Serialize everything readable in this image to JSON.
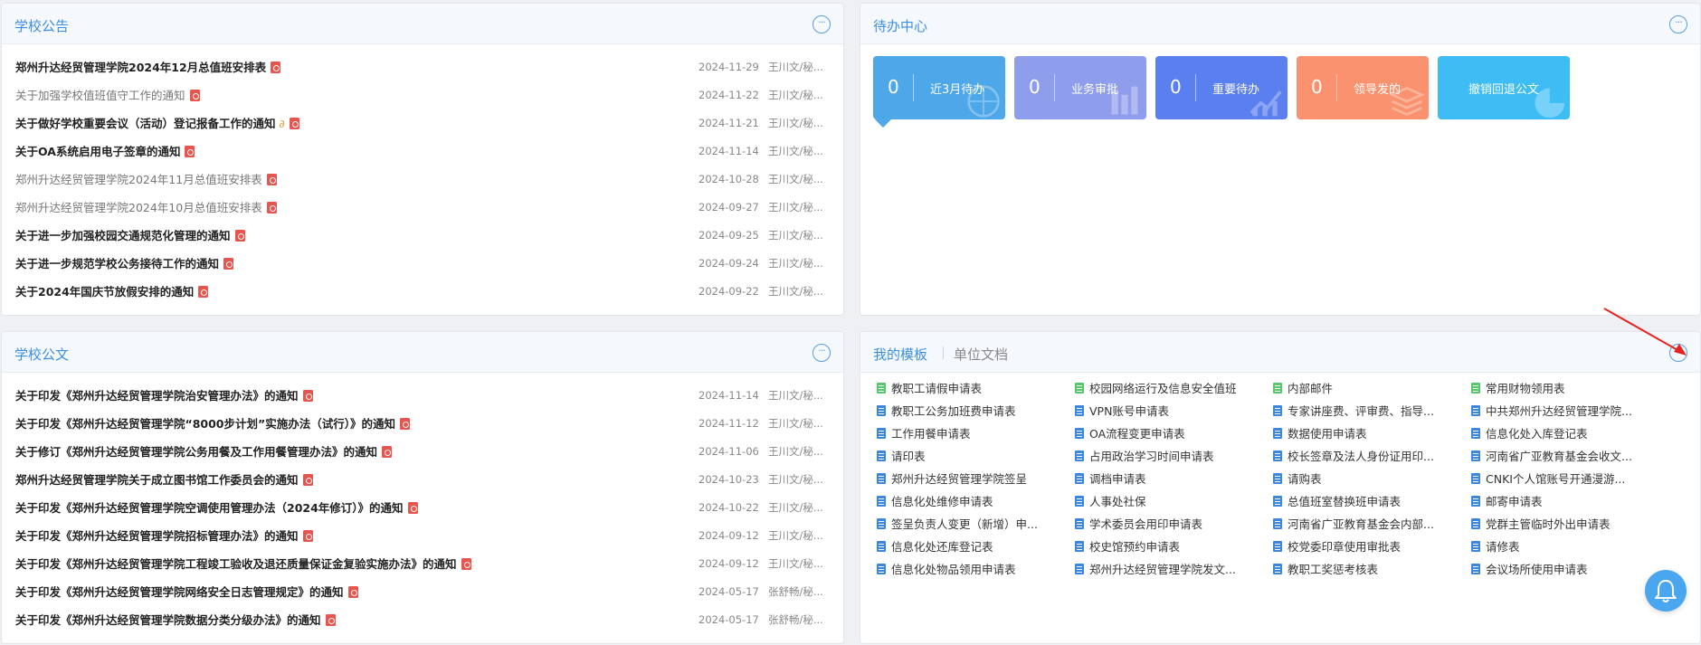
{
  "notices": {
    "title": "学校公告",
    "items": [
      {
        "title": "郑州升达经贸管理学院2024年12月总值班安排表",
        "date": "2024-11-29",
        "author": "王川文/秘...",
        "bold": true,
        "gray": false,
        "clip": false
      },
      {
        "title": "关于加强学校值班值守工作的通知",
        "date": "2024-11-22",
        "author": "王川文/秘...",
        "bold": false,
        "gray": true,
        "clip": false
      },
      {
        "title": "关于做好学校重要会议（活动）登记报备工作的通知",
        "date": "2024-11-21",
        "author": "王川文/秘...",
        "bold": true,
        "gray": false,
        "clip": true
      },
      {
        "title": "关于OA系统启用电子签章的通知",
        "date": "2024-11-14",
        "author": "王川文/秘...",
        "bold": true,
        "gray": false,
        "clip": false
      },
      {
        "title": "郑州升达经贸管理学院2024年11月总值班安排表",
        "date": "2024-10-28",
        "author": "王川文/秘...",
        "bold": false,
        "gray": true,
        "clip": false
      },
      {
        "title": "郑州升达经贸管理学院2024年10月总值班安排表",
        "date": "2024-09-27",
        "author": "王川文/秘...",
        "bold": false,
        "gray": true,
        "clip": false
      },
      {
        "title": "关于进一步加强校园交通规范化管理的通知",
        "date": "2024-09-25",
        "author": "王川文/秘...",
        "bold": true,
        "gray": false,
        "clip": false
      },
      {
        "title": "关于进一步规范学校公务接待工作的通知",
        "date": "2024-09-24",
        "author": "王川文/秘...",
        "bold": true,
        "gray": false,
        "clip": false
      },
      {
        "title": "关于2024年国庆节放假安排的通知",
        "date": "2024-09-22",
        "author": "王川文/秘...",
        "bold": true,
        "gray": false,
        "clip": false
      }
    ]
  },
  "documents": {
    "title": "学校公文",
    "items": [
      {
        "title": "关于印发《郑州升达经贸管理学院治安管理办法》的通知",
        "date": "2024-11-14",
        "author": "王川文/秘..."
      },
      {
        "title": "关于印发《郑州升达经贸管理学院“8000步计划”实施办法（试行）》的通知",
        "date": "2024-11-12",
        "author": "王川文/秘..."
      },
      {
        "title": "关于修订《郑州升达经贸管理学院公务用餐及工作用餐管理办法》的通知",
        "date": "2024-11-06",
        "author": "王川文/秘..."
      },
      {
        "title": "郑州升达经贸管理学院关于成立图书馆工作委员会的通知",
        "date": "2024-10-23",
        "author": "王川文/秘..."
      },
      {
        "title": "关于印发《郑州升达经贸管理学院空调使用管理办法（2024年修订）》的通知",
        "date": "2024-10-22",
        "author": "王川文/秘..."
      },
      {
        "title": "关于印发《郑州升达经贸管理学院招标管理办法》的通知",
        "date": "2024-09-12",
        "author": "王川文/秘..."
      },
      {
        "title": "关于印发《郑州升达经贸管理学院工程竣工验收及退还质量保证金复验实施办法》的通知",
        "date": "2024-09-12",
        "author": "王川文/秘..."
      },
      {
        "title": "关于印发《郑州升达经贸管理学院网络安全日志管理规定》的通知",
        "date": "2024-05-17",
        "author": "张舒畅/秘..."
      },
      {
        "title": "关于印发《郑州升达经贸管理学院数据分类分级办法》的通知",
        "date": "2024-05-17",
        "author": "张舒畅/秘..."
      }
    ]
  },
  "todo": {
    "title": "待办中心",
    "tiles": [
      {
        "count": "0",
        "label": "近3月待办",
        "color": "#4ea7e8"
      },
      {
        "count": "0",
        "label": "业务审批",
        "color": "#8f9ded"
      },
      {
        "count": "0",
        "label": "重要待办",
        "color": "#5a7fee"
      },
      {
        "count": "0",
        "label": "领导发的",
        "color": "#fa9270"
      },
      {
        "count": "",
        "label": "撤销回退公文",
        "color": "#3ebdf5"
      }
    ]
  },
  "templates": {
    "tab_active": "我的模板",
    "tab_inactive": "单位文档",
    "columns": [
      [
        {
          "label": "教职工请假申请表",
          "icon": "green"
        },
        {
          "label": "教职工公务加班费申请表",
          "icon": "blue"
        },
        {
          "label": "工作用餐申请表",
          "icon": "blue"
        },
        {
          "label": "请印表",
          "icon": "blue"
        },
        {
          "label": "郑州升达经贸管理学院签呈",
          "icon": "blue"
        },
        {
          "label": "信息化处维修申请表",
          "icon": "blue"
        },
        {
          "label": "签呈负责人变更（新增）申...",
          "icon": "blue"
        },
        {
          "label": "信息化处还库登记表",
          "icon": "blue"
        },
        {
          "label": "信息化处物品领用申请表",
          "icon": "blue"
        }
      ],
      [
        {
          "label": "校园网络运行及信息安全值班",
          "icon": "green"
        },
        {
          "label": "VPN账号申请表",
          "icon": "blue"
        },
        {
          "label": "OA流程变更申请表",
          "icon": "blue"
        },
        {
          "label": "占用政治学习时间申请表",
          "icon": "blue"
        },
        {
          "label": "调档申请表",
          "icon": "blue"
        },
        {
          "label": "人事处社保",
          "icon": "blue"
        },
        {
          "label": "学术委员会用印申请表",
          "icon": "blue"
        },
        {
          "label": "校史馆预约申请表",
          "icon": "blue"
        },
        {
          "label": "郑州升达经贸管理学院发文...",
          "icon": "blue"
        }
      ],
      [
        {
          "label": "内部邮件",
          "icon": "green"
        },
        {
          "label": "专家讲座费、评审费、指导...",
          "icon": "blue"
        },
        {
          "label": "数据使用申请表",
          "icon": "blue"
        },
        {
          "label": "校长签章及法人身份证用印...",
          "icon": "blue"
        },
        {
          "label": "请购表",
          "icon": "blue"
        },
        {
          "label": "总值班室替换班申请表",
          "icon": "blue"
        },
        {
          "label": "河南省广亚教育基金会内部...",
          "icon": "blue"
        },
        {
          "label": "校党委印章使用审批表",
          "icon": "blue"
        },
        {
          "label": "教职工奖惩考核表",
          "icon": "blue"
        }
      ],
      [
        {
          "label": "常用财物领用表",
          "icon": "green"
        },
        {
          "label": "中共郑州升达经贸管理学院...",
          "icon": "blue"
        },
        {
          "label": "信息化处入库登记表",
          "icon": "blue"
        },
        {
          "label": "河南省广亚教育基金会收文...",
          "icon": "blue"
        },
        {
          "label": "CNKI个人馆账号开通漫游...",
          "icon": "blue"
        },
        {
          "label": "邮寄申请表",
          "icon": "blue"
        },
        {
          "label": "党群主管临时外出申请表",
          "icon": "blue"
        },
        {
          "label": "请修表",
          "icon": "blue"
        },
        {
          "label": "会议场所使用申请表",
          "icon": "blue"
        }
      ]
    ]
  },
  "colors": {
    "accent": "#3d8fe0",
    "pdf": "#e8554e",
    "annotation": "#e8231f"
  }
}
